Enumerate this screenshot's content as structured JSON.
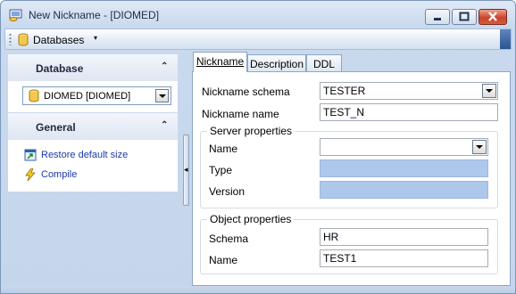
{
  "window": {
    "title": "New Nickname - [DIOMED]",
    "icon": "nickname-app-icon"
  },
  "toolbar": {
    "databases_label": "Databases",
    "arrow": "▾"
  },
  "left": {
    "database_header": "Database",
    "database_combo_value": "DIOMED [DIOMED]",
    "general_header": "General",
    "links": [
      {
        "label": "Restore default size",
        "icon": "restore-size-icon"
      },
      {
        "label": "Compile",
        "icon": "compile-lightning-icon"
      }
    ],
    "collapse_glyph": "«"
  },
  "tabs": [
    {
      "label": "Nickname",
      "active": true
    },
    {
      "label": "Description",
      "active": false
    },
    {
      "label": "DDL",
      "active": false
    }
  ],
  "form": {
    "nickname_schema_label": "Nickname schema",
    "nickname_schema_value": "TESTER",
    "nickname_name_label": "Nickname name",
    "nickname_name_value": "TEST_N",
    "server_group_title": "Server properties",
    "server_name_label": "Name",
    "server_name_value": "",
    "type_label": "Type",
    "type_value": "",
    "version_label": "Version",
    "version_value": "",
    "object_group_title": "Object properties",
    "schema_label": "Schema",
    "schema_value": "HR",
    "object_name_label": "Name",
    "object_name_value": "TEST1"
  },
  "colors": {
    "accent": "#1a3aa8",
    "disabled_field": "#aec8ec",
    "close_button": "#c9452c"
  }
}
